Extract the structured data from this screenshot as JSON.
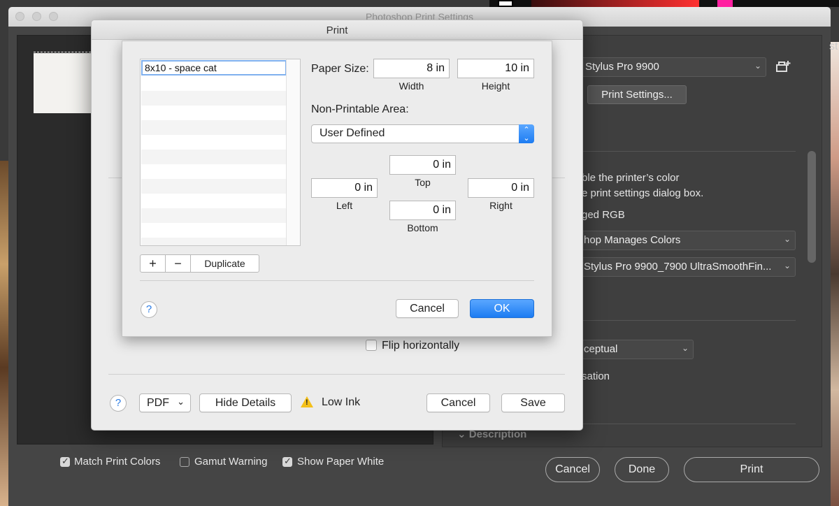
{
  "photoshop": {
    "window_title": "Photoshop Print Settings",
    "printer_name": "Stylus Pro 9900",
    "print_settings_button": "Print Settings...",
    "color_text_line1": "ble the printer’s color",
    "color_text_line2": "e print settings dialog box.",
    "profile_label": "ged RGB",
    "color_handling": "hop Manages Colors",
    "printer_profile": "Stylus Pro 9900_7900 UltraSmoothFin...",
    "rendering_intent": "ceptual",
    "bpc_label": "sation",
    "description_label": "Description",
    "edge_text": "st",
    "bottom": {
      "match_print_colors": "Match Print Colors",
      "gamut_warning": "Gamut Warning",
      "show_paper_white": "Show Paper White",
      "cancel": "Cancel",
      "done": "Done",
      "print": "Print"
    }
  },
  "print_dialog": {
    "title": "Print",
    "flip_horizontally": "Flip horizontally",
    "help": "?",
    "pdf": "PDF",
    "hide_details": "Hide Details",
    "low_ink": "Low Ink",
    "cancel": "Cancel",
    "save": "Save"
  },
  "custom_paper": {
    "list_items": [
      "8x10 - space cat"
    ],
    "add": "+",
    "remove": "−",
    "duplicate": "Duplicate",
    "paper_size_label": "Paper Size:",
    "width_value": "8 in",
    "width_label": "Width",
    "height_value": "10 in",
    "height_label": "Height",
    "non_printable_label": "Non-Printable Area:",
    "non_printable_option": "User Defined",
    "top_value": "0 in",
    "top_label": "Top",
    "left_value": "0 in",
    "left_label": "Left",
    "right_value": "0 in",
    "right_label": "Right",
    "bottom_value": "0 in",
    "bottom_label": "Bottom",
    "help": "?",
    "cancel": "Cancel",
    "ok": "OK"
  }
}
